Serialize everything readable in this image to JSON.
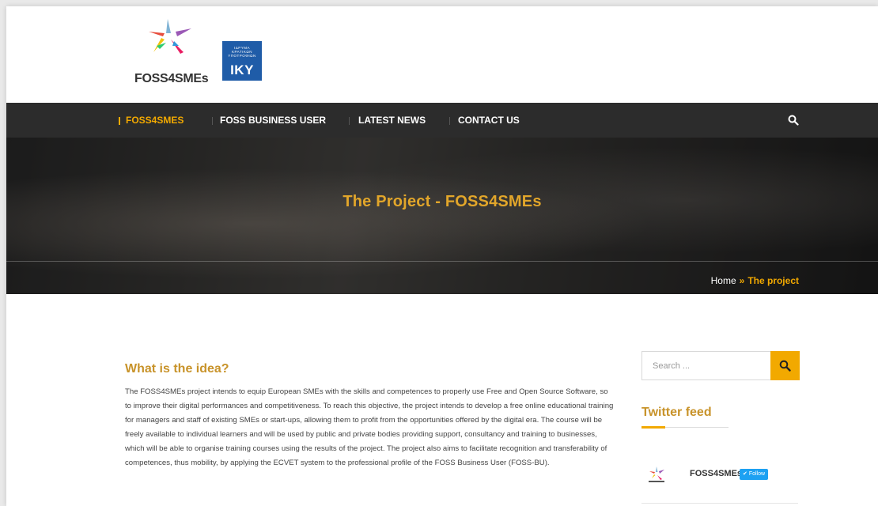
{
  "header": {
    "logo_text": "FOSS4SMEs",
    "iky_small_lines": [
      "ΙΔΡΥΜΑ",
      "ΚΡΑΤΙΚΩΝ",
      "ΥΠΟΤΡΟΦΙΩΝ"
    ],
    "iky_big": "IKY"
  },
  "nav": {
    "items": [
      {
        "label": "FOSS4SMES",
        "active": true
      },
      {
        "label": "FOSS BUSINESS USER",
        "active": false
      },
      {
        "label": "LATEST NEWS",
        "active": false
      },
      {
        "label": "CONTACT US",
        "active": false
      }
    ],
    "search_icon": "search-icon"
  },
  "hero": {
    "title": "The Project - FOSS4SMEs",
    "breadcrumb": {
      "home": "Home",
      "separator": "»",
      "current": "The project"
    }
  },
  "main": {
    "title": "What is the idea?",
    "body": "The FOSS4SMEs project intends to equip European SMEs with the skills and competences to properly use Free and Open Source Software, so to improve their digital performances and competitiveness. To reach this objective, the project intends to develop a free online educational training for managers and staff of existing SMEs or start-ups, allowing them to profit from the opportunities offered by the digital era. The course will be freely available to individual learners and will be used by public and private bodies providing support, consultancy and training to businesses, which will be able to organise training courses using the results of the project. The project also aims to facilitate recognition and transferability of competences, thus mobility, by applying the ECVET system to the professional profile of the FOSS Business User (FOSS-BU)."
  },
  "sidebar": {
    "search": {
      "placeholder": "Search ...",
      "value": ""
    },
    "twitter": {
      "title": "Twitter feed",
      "account": "FOSS4SMEs",
      "follow_label": "Follow"
    }
  },
  "colors": {
    "accent": "#f2a900",
    "heading": "#c8932a",
    "nav_bg": "#2c2c2c",
    "iky_blue": "#1f5ca8",
    "twitter_blue": "#1da1f2"
  }
}
